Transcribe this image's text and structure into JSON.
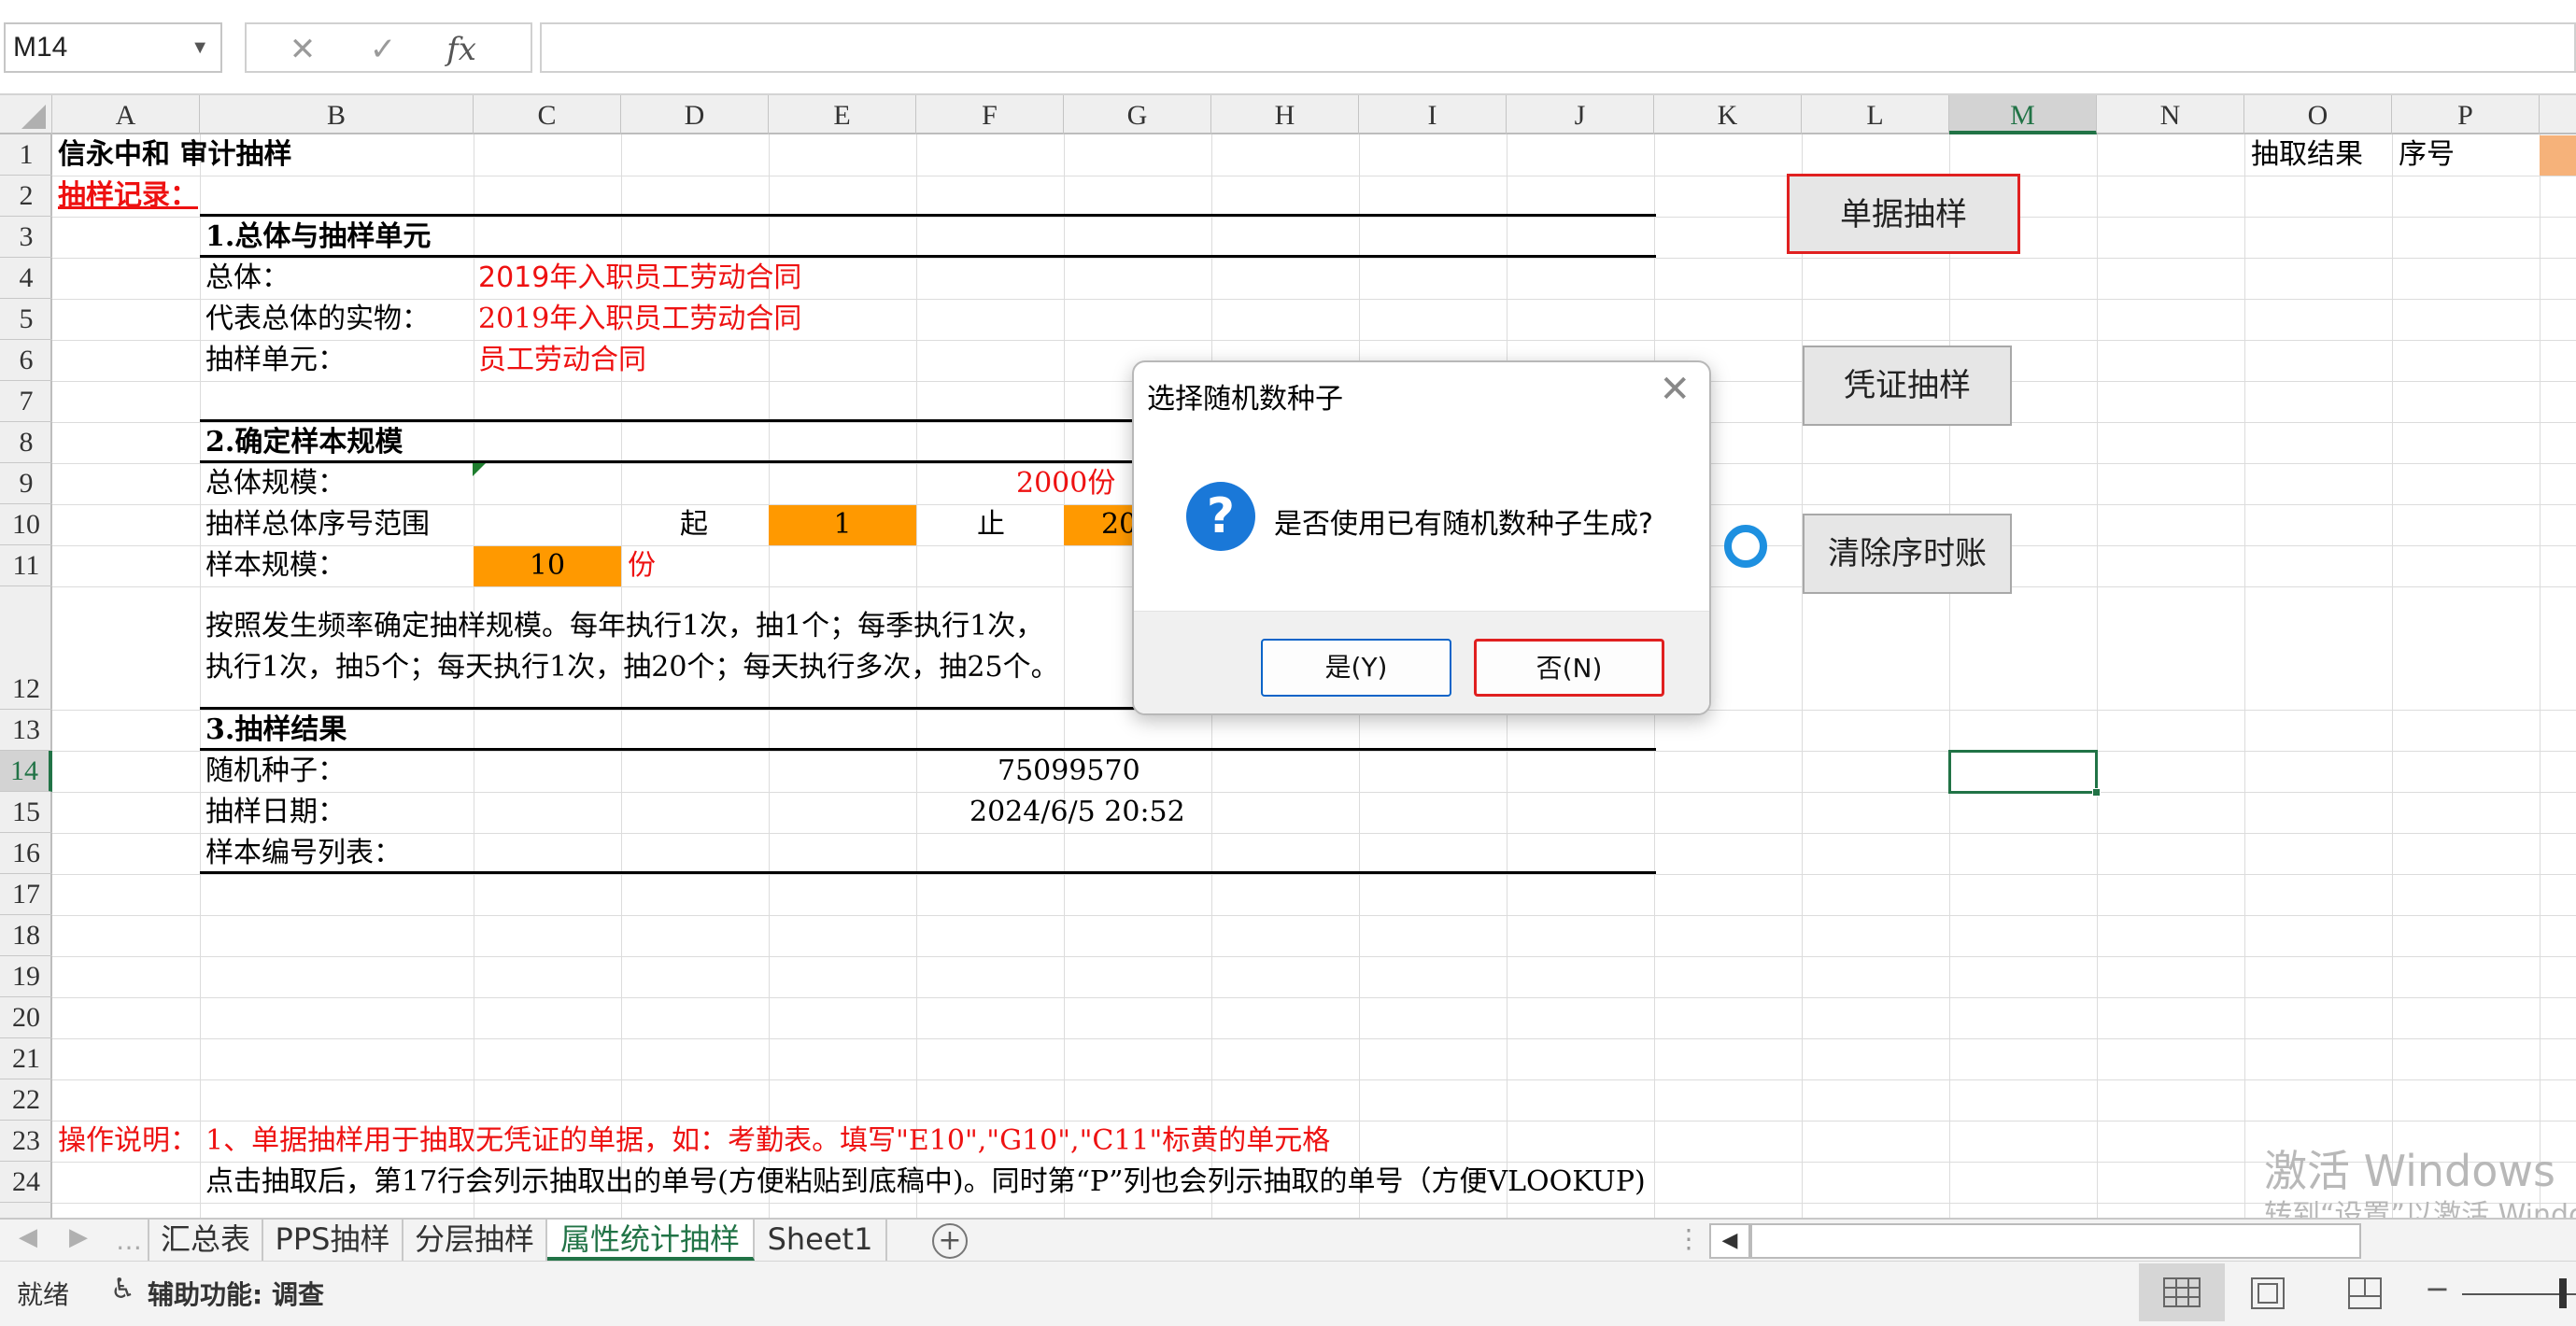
{
  "formula_bar": {
    "name_box": "M14",
    "cancel_icon": "✕",
    "enter_icon": "✓",
    "fx_icon": "fx",
    "formula": ""
  },
  "columns": [
    "A",
    "B",
    "C",
    "D",
    "E",
    "F",
    "G",
    "H",
    "I",
    "J",
    "K",
    "L",
    "M",
    "N",
    "O",
    "P"
  ],
  "rows": [
    "1",
    "2",
    "3",
    "4",
    "5",
    "6",
    "7",
    "8",
    "9",
    "10",
    "11",
    "12",
    "13",
    "14",
    "15",
    "16",
    "17",
    "18",
    "19",
    "20",
    "21",
    "22",
    "23",
    "24"
  ],
  "sheet": {
    "title": "信永中和  审计抽样",
    "record_label": "抽样记录：",
    "section1": "1.总体与抽样单元",
    "population_label": "总体：",
    "population_value": "2019年入职员工劳动合同",
    "physical_label": "代表总体的实物：",
    "physical_value": "2019年入职员工劳动合同",
    "unit_label": "抽样单元：",
    "unit_value": "员工劳动合同",
    "section2": "2.确定样本规模",
    "pop_size_label": "总体规模：",
    "pop_size_value": "2000份",
    "range_label": "抽样总体序号范围",
    "range_start_label": "起",
    "range_start": "1",
    "range_end_label": "止",
    "range_end": "20",
    "sample_size_label": "样本规模：",
    "sample_size": "10",
    "sample_unit": "份",
    "freq_note_1": "按照发生频率确定抽样规模。每年执行1次，抽1个；每季执行1次，",
    "freq_note_2": "执行1次，抽5个；每天执行1次，抽20个；每天执行多次，抽25个。",
    "section3": "3.抽样结果",
    "seed_label": "随机种子：",
    "seed_value": "75099570",
    "date_label": "抽样日期：",
    "date_value": "2024/6/5 20:52",
    "list_label": "样本编号列表：",
    "ops_label": "操作说明：",
    "ops_line1": "1、单据抽样用于抽取无凭证的单据，如：考勤表。填写\"E10\",\"G10\",\"C11\"标黄的单元格",
    "ops_line2": "点击抽取后，第17行会列示抽取出的单号(方便粘贴到底稿中)。同时第“P”列也会列示抽取的单号（方便VLOOKUP)",
    "result_header": "抽取结果",
    "seq_header": "序号"
  },
  "buttons": {
    "doc_sampling": "单据抽样",
    "voucher_sampling": "凭证抽样",
    "clear_ledger": "清除序时账"
  },
  "dialog": {
    "title": "选择随机数种子",
    "message": "是否使用已有随机数种子生成?",
    "yes": "是(Y)",
    "no": "否(N)",
    "close_icon": "✕",
    "question_icon": "?"
  },
  "tabs": [
    "汇总表",
    "PPS抽样",
    "分层抽样",
    "属性统计抽样",
    "Sheet1"
  ],
  "active_tab": "属性统计抽样",
  "watermark": {
    "line1": "激活 Windows",
    "line2": "转到“设置”以激活 Windows。"
  },
  "status": {
    "ready": "就绪",
    "accessibility": "辅助功能: 调查"
  },
  "colors": {
    "accent_green": "#217346",
    "orange": "#ff9900",
    "red_text": "#ee1111",
    "dialog_blue": "#1a78d8"
  }
}
